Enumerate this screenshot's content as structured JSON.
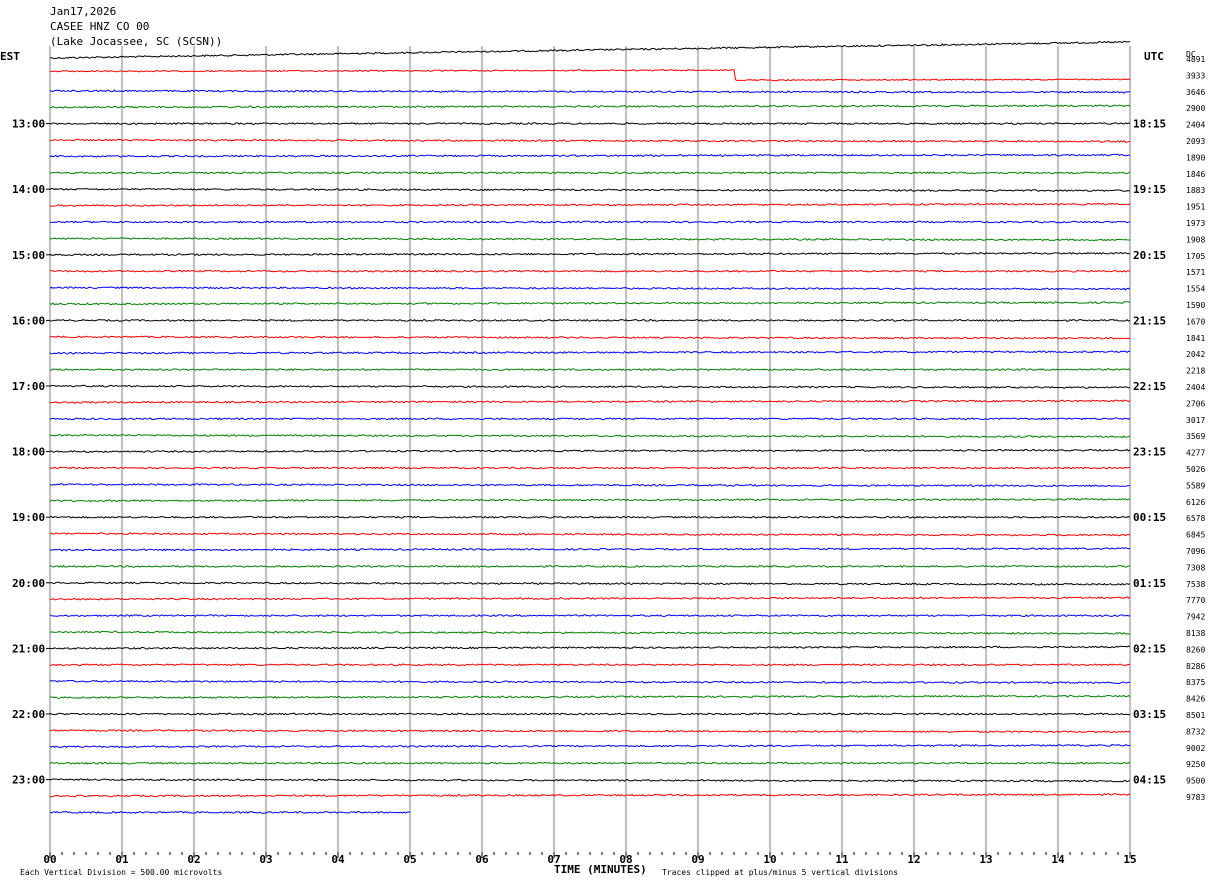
{
  "header": {
    "date": "Jan17,2026",
    "station": "CASEE HNZ CO 00",
    "location": "(Lake Jocassee, SC (SCSN))"
  },
  "left_timezone": "EST",
  "right_timezone": "UTC",
  "dc_label": "DC",
  "left_hour_labels": [
    "13:00",
    "14:00",
    "15:00",
    "16:00",
    "17:00",
    "18:00",
    "19:00",
    "20:00",
    "21:00",
    "22:00",
    "23:00"
  ],
  "right_hour_labels": [
    "18:15",
    "19:15",
    "20:15",
    "21:15",
    "22:15",
    "23:15",
    "00:15",
    "01:15",
    "02:15",
    "03:15",
    "04:15"
  ],
  "footer": {
    "scale_note": "Each Vertical Division =  500.00 microvolts",
    "x_title": "TIME (MINUTES)",
    "clip_note": "Traces clipped at plus/minus 5 vertical divisions"
  },
  "colors": {
    "trace_cycle": [
      "#000000",
      "#ff0000",
      "#0000ff",
      "#008000"
    ],
    "grid": "#808080",
    "text": "#000000"
  },
  "chart_data": {
    "type": "line",
    "title": "CASEE HNZ CO 00",
    "xlabel": "TIME (MINUTES)",
    "x_ticks": [
      "00",
      "01",
      "02",
      "03",
      "04",
      "05",
      "06",
      "07",
      "08",
      "09",
      "10",
      "11",
      "12",
      "13",
      "14",
      "15"
    ],
    "xlim": [
      0,
      15
    ],
    "rows": 47,
    "last_row_end_minute": 5.0,
    "first_row_start_minute": 0,
    "dc_offsets": [
      4891,
      3933,
      3646,
      2900,
      2404,
      2093,
      1890,
      1846,
      1883,
      1951,
      1973,
      1908,
      1705,
      1571,
      1554,
      1590,
      1670,
      1841,
      2042,
      2218,
      2404,
      2706,
      3017,
      3569,
      4277,
      5026,
      5589,
      6126,
      6578,
      6845,
      7096,
      7308,
      7538,
      7770,
      7942,
      8138,
      8260,
      8286,
      8375,
      8426,
      8501,
      8732,
      9002,
      9250,
      9500,
      9783
    ],
    "step_event": {
      "row": 1,
      "minute": 9.5,
      "direction": "down"
    },
    "grid": true
  }
}
